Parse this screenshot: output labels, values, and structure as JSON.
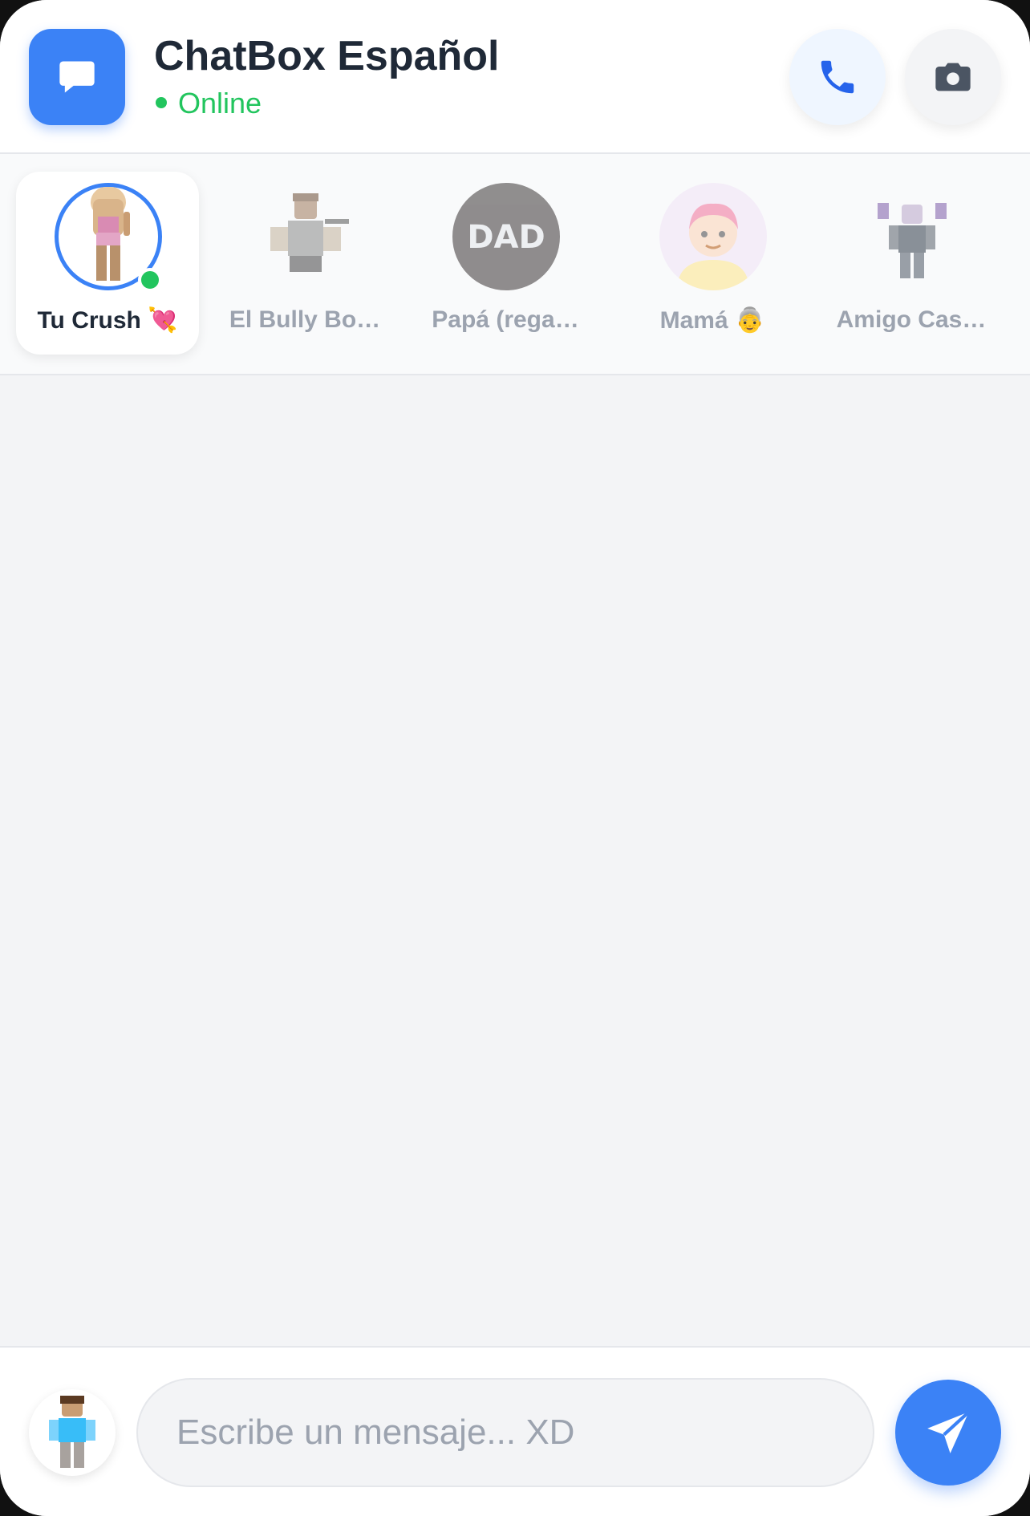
{
  "header": {
    "title": "ChatBox Español",
    "status": "Online",
    "logo_icon": "chat-bubble-icon",
    "call_icon": "phone-icon",
    "camera_icon": "camera-icon"
  },
  "contacts": [
    {
      "name": "Tu Crush 💘",
      "avatar": "roblox-girl-avatar",
      "active": true,
      "online": true
    },
    {
      "name": "El Bully Bo…",
      "avatar": "roblox-bully-avatar",
      "active": false
    },
    {
      "name": "Papá (rega…",
      "avatar": "dad-logo-avatar",
      "active": false
    },
    {
      "name": "Mamá 👵",
      "avatar": "cartoon-mom-avatar",
      "active": false
    },
    {
      "name": "Amigo Cas…",
      "avatar": "roblox-friend-avatar",
      "active": false
    }
  ],
  "composer": {
    "placeholder": "Escribe un mensaje... XD",
    "value": "",
    "send_icon": "send-icon",
    "user_avatar": "roblox-user-avatar"
  },
  "colors": {
    "accent": "#3b82f6",
    "online": "#22c55e",
    "background": "#f3f4f6"
  }
}
